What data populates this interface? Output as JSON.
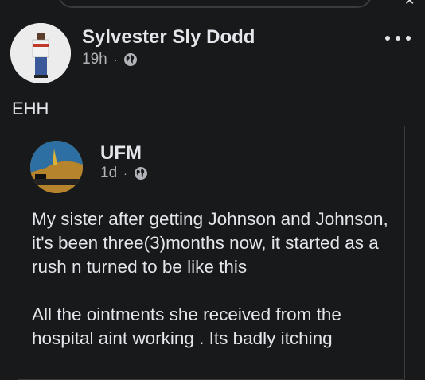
{
  "post": {
    "author": "Sylvester Sly Dodd",
    "time": "19h",
    "separator": "·",
    "text": "EHH",
    "icons": {
      "privacy": "globe-icon",
      "more": "more-options-icon"
    }
  },
  "shared_post": {
    "author": "UFM",
    "time": "1d",
    "separator": "·",
    "paragraphs": [
      "My sister after getting Johnson and Johnson, it's been three(3)months now, it started as a rush n turned to be like this",
      "All the ointments she received from the hospital aint working . Its badly itching"
    ],
    "icons": {
      "privacy": "globe-icon"
    }
  }
}
